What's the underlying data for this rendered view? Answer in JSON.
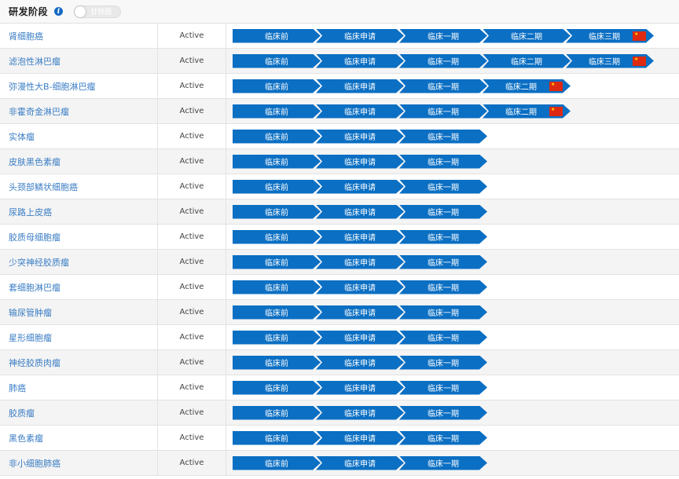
{
  "header": {
    "title": "研发阶段",
    "toggle_label": "甘特图"
  },
  "status_default": "Active",
  "rows": [
    {
      "name": "肾细胞癌",
      "status": "Active",
      "phases": [
        "临床前",
        "临床申请",
        "临床一期",
        "临床二期",
        "临床三期"
      ],
      "flag": true
    },
    {
      "name": "滤泡性淋巴瘤",
      "status": "Active",
      "phases": [
        "临床前",
        "临床申请",
        "临床一期",
        "临床二期",
        "临床三期"
      ],
      "flag": true
    },
    {
      "name": "弥漫性大B-细胞淋巴瘤",
      "status": "Active",
      "phases": [
        "临床前",
        "临床申请",
        "临床一期",
        "临床二期"
      ],
      "flag": true
    },
    {
      "name": "非霍奇金淋巴瘤",
      "status": "Active",
      "phases": [
        "临床前",
        "临床申请",
        "临床一期",
        "临床二期"
      ],
      "flag": true
    },
    {
      "name": "实体瘤",
      "status": "Active",
      "phases": [
        "临床前",
        "临床申请",
        "临床一期"
      ],
      "flag": false
    },
    {
      "name": "皮肤黑色素瘤",
      "status": "Active",
      "phases": [
        "临床前",
        "临床申请",
        "临床一期"
      ],
      "flag": false
    },
    {
      "name": "头颈部鳞状细胞癌",
      "status": "Active",
      "phases": [
        "临床前",
        "临床申请",
        "临床一期"
      ],
      "flag": false
    },
    {
      "name": "尿路上皮癌",
      "status": "Active",
      "phases": [
        "临床前",
        "临床申请",
        "临床一期"
      ],
      "flag": false
    },
    {
      "name": "胶质母细胞瘤",
      "status": "Active",
      "phases": [
        "临床前",
        "临床申请",
        "临床一期"
      ],
      "flag": false
    },
    {
      "name": "少突神经胶质瘤",
      "status": "Active",
      "phases": [
        "临床前",
        "临床申请",
        "临床一期"
      ],
      "flag": false
    },
    {
      "name": "套细胞淋巴瘤",
      "status": "Active",
      "phases": [
        "临床前",
        "临床申请",
        "临床一期"
      ],
      "flag": false
    },
    {
      "name": "输尿管肿瘤",
      "status": "Active",
      "phases": [
        "临床前",
        "临床申请",
        "临床一期"
      ],
      "flag": false
    },
    {
      "name": "星形细胞瘤",
      "status": "Active",
      "phases": [
        "临床前",
        "临床申请",
        "临床一期"
      ],
      "flag": false
    },
    {
      "name": "神经胶质肉瘤",
      "status": "Active",
      "phases": [
        "临床前",
        "临床申请",
        "临床一期"
      ],
      "flag": false
    },
    {
      "name": "肺癌",
      "status": "Active",
      "phases": [
        "临床前",
        "临床申请",
        "临床一期"
      ],
      "flag": false
    },
    {
      "name": "胶质瘤",
      "status": "Active",
      "phases": [
        "临床前",
        "临床申请",
        "临床一期"
      ],
      "flag": false
    },
    {
      "name": "黑色素瘤",
      "status": "Active",
      "phases": [
        "临床前",
        "临床申请",
        "临床一期"
      ],
      "flag": false
    },
    {
      "name": "非小细胞肺癌",
      "status": "Active",
      "phases": [
        "临床前",
        "临床申请",
        "临床一期"
      ],
      "flag": false
    }
  ],
  "colors": {
    "phase_blue": "#0b6fc3",
    "link_blue": "#3a7dc4",
    "flag_red": "#de2910"
  },
  "icons": {
    "info": "info-icon",
    "flag": "china-flag-icon"
  }
}
